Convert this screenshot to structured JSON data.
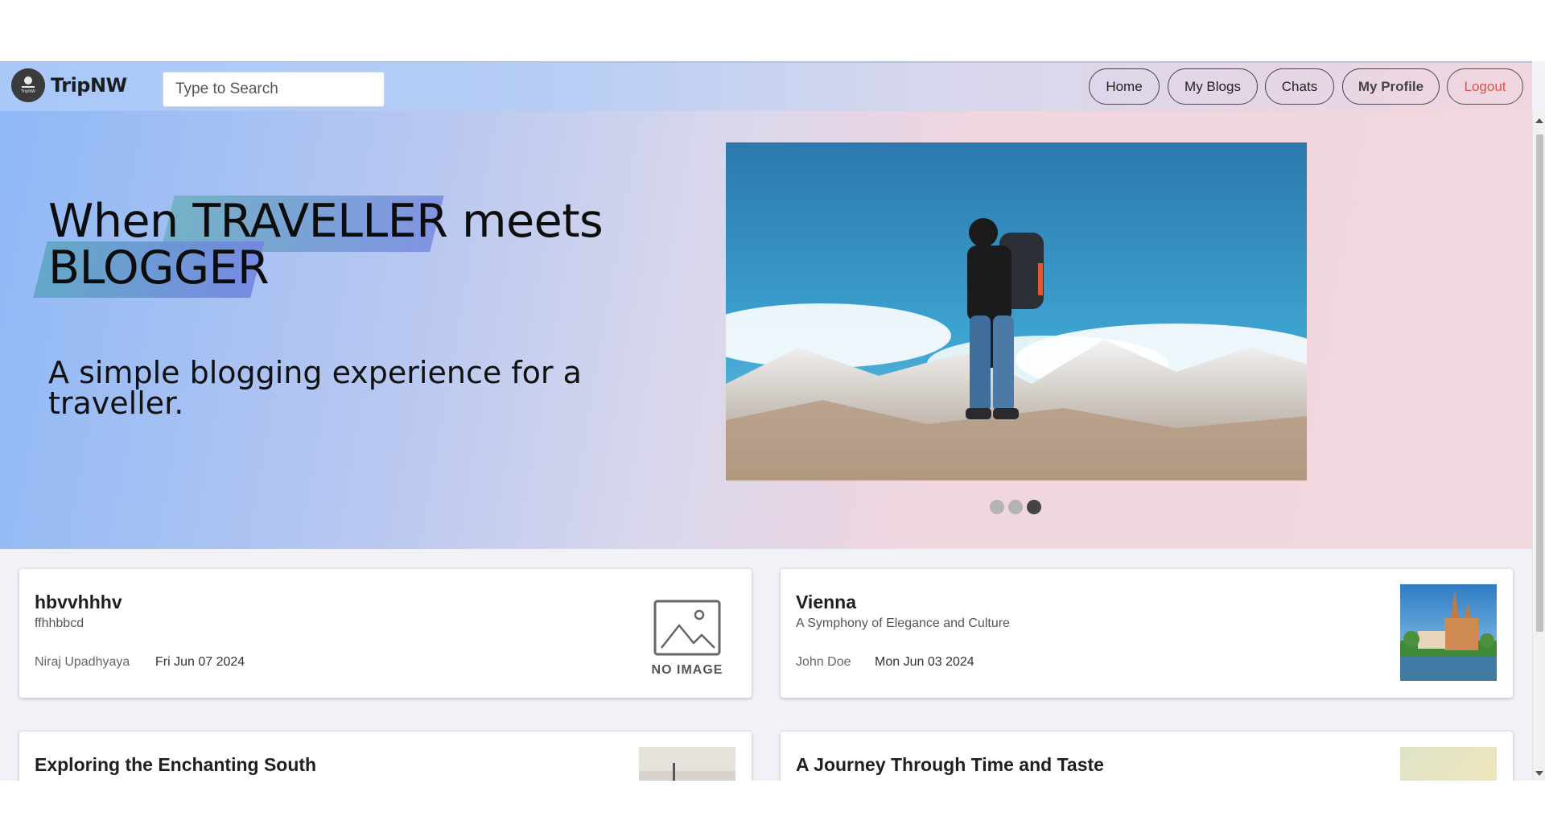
{
  "header": {
    "brand": "TripNW",
    "logo_small_text": "TripNW",
    "search": {
      "placeholder": "Type to Search",
      "value": ""
    },
    "nav": {
      "home": "Home",
      "my_blogs": "My Blogs",
      "chats": "Chats",
      "my_profile": "My Profile",
      "logout": "Logout"
    }
  },
  "hero": {
    "headline_part1": "When ",
    "headline_part2": "TRAVELLER",
    "headline_part3": " meets",
    "headline_part4": "BLOGGER",
    "subline": "A simple blogging experience for a traveller.",
    "carousel": {
      "slides": 3,
      "active_index": 2
    }
  },
  "cards": [
    {
      "title": "hbvvhhhv",
      "subtitle": "ffhhbbcd",
      "author": "Niraj Upadhyaya",
      "date": "Fri Jun 07 2024",
      "image": "none",
      "no_image_label": "NO IMAGE"
    },
    {
      "title": "Vienna",
      "subtitle": "A Symphony of Elegance and Culture",
      "author": "John Doe",
      "date": "Mon Jun 03 2024",
      "image": "vienna-church-thumbnail"
    },
    {
      "title": "Exploring the Enchanting South",
      "image": "coastal-landscape-thumbnail"
    },
    {
      "title": "A Journey Through Time and Taste",
      "image": "sunset-thumbnail"
    }
  ],
  "colors": {
    "logout": "#d9534f",
    "hero_left": "#8fb8f6",
    "hero_right": "#f2d7de",
    "highlight": "#7a8ee0"
  }
}
